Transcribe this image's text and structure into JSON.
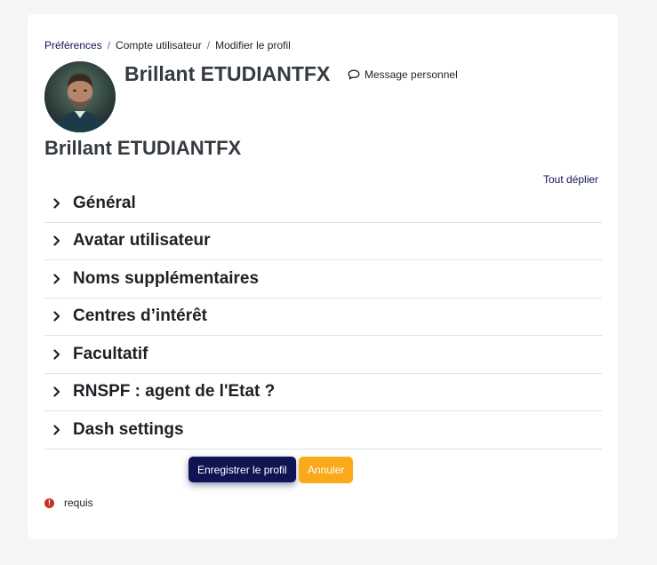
{
  "breadcrumb": {
    "items": [
      "Préférences",
      "Compte utilisateur",
      "Modifier le profil"
    ],
    "separator": "/"
  },
  "profile": {
    "name": "Brillant ETUDIANTFX",
    "message_label": "Message personnel"
  },
  "page_title": "Brillant ETUDIANTFX",
  "expand_all_label": "Tout déplier",
  "sections": [
    {
      "label": "Général"
    },
    {
      "label": "Avatar utilisateur"
    },
    {
      "label": "Noms supplémentaires"
    },
    {
      "label": "Centres d’intérêt"
    },
    {
      "label": "Facultatif"
    },
    {
      "label": "RNSPF : agent de l'Etat ?"
    },
    {
      "label": "Dash settings"
    }
  ],
  "buttons": {
    "save_label": "Enregistrer le profil",
    "cancel_label": "Annuler"
  },
  "required_note": {
    "icon_text": "!",
    "text": "requis"
  },
  "icons": {
    "message": "speech-bubble-icon",
    "section_toggle": "chevron-right-icon",
    "required": "exclamation-circle-icon"
  },
  "colors": {
    "primary": "#0f1453",
    "secondary": "#f9a91a",
    "required": "#ca3120"
  }
}
